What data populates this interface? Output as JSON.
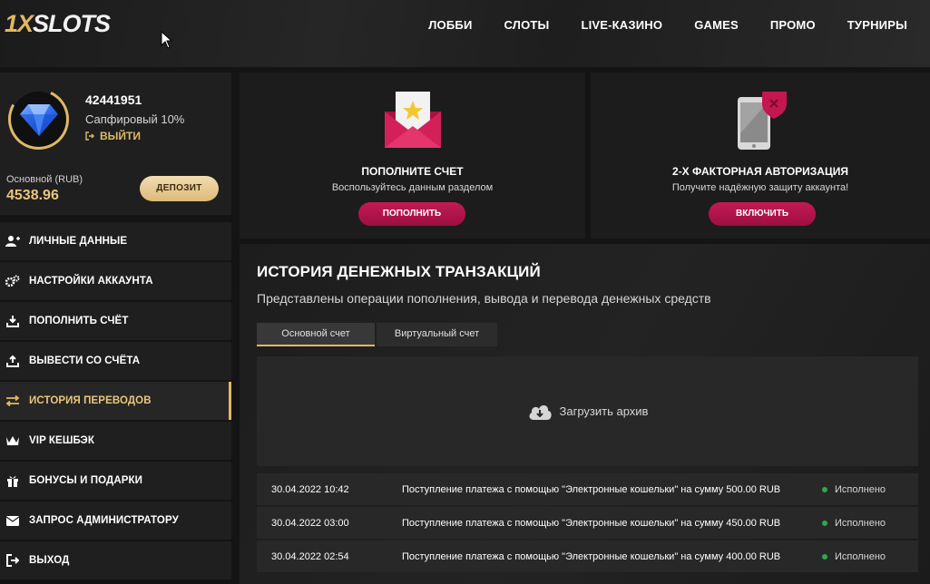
{
  "header": {
    "logo_part1": "1X",
    "logo_part2": "SLOTS",
    "nav": [
      "ЛОББИ",
      "СЛОТЫ",
      "LIVE-КАЗИНО",
      "GAMES",
      "ПРОМО",
      "ТУРНИРЫ"
    ]
  },
  "profile": {
    "user_id": "42441951",
    "level": "Сапфировый 10%",
    "logout_label": "ВЫЙТИ",
    "account_label": "Основной (RUB)",
    "balance": "4538.96",
    "deposit_label": "ДЕПОЗИТ",
    "avatar_icon": "diamond-icon"
  },
  "menu": [
    {
      "label": "ЛИЧНЫЕ ДАННЫЕ",
      "icon": "user-edit-icon"
    },
    {
      "label": "НАСТРОЙКИ АККАУНТА",
      "icon": "gears-icon"
    },
    {
      "label": "ПОПОЛНИТЬ СЧЁТ",
      "icon": "download-icon"
    },
    {
      "label": "ВЫВЕСТИ СО СЧЁТА",
      "icon": "upload-icon"
    },
    {
      "label": "ИСТОРИЯ ПЕРЕВОДОВ",
      "icon": "transfer-arrows-icon",
      "active": true
    },
    {
      "label": "VIP КЕШБЭК",
      "icon": "crown-icon"
    },
    {
      "label": "БОНУСЫ И ПОДАРКИ",
      "icon": "gift-icon"
    },
    {
      "label": "ЗАПРОС АДМИНИСТРАТОРУ",
      "icon": "envelope-icon"
    },
    {
      "label": "ВЫХОД",
      "icon": "logout-icon"
    }
  ],
  "promo": {
    "deposit_card": {
      "title": "ПОПОЛНИТЕ СЧЕТ",
      "subtitle": "Воспользуйтесь данным разделом",
      "button": "ПОПОЛНИТЬ",
      "icon": "envelope-star-icon"
    },
    "twofa_card": {
      "title": "2-Х ФАКТОРНАЯ АВТОРИЗАЦИЯ",
      "subtitle": "Получите надёжную защиту аккаунта!",
      "button": "ВКЛЮЧИТЬ",
      "icon": "phone-shield-icon"
    }
  },
  "main": {
    "title": "ИСТОРИЯ ДЕНЕЖНЫХ ТРАНЗАКЦИЙ",
    "subtitle": "Представлены операции пополнения, вывода и перевода денежных средств",
    "tabs": [
      "Основной счет",
      "Виртуальный счет"
    ],
    "active_tab": "Основной счет",
    "archive_label": "Загрузить архив",
    "transactions": [
      {
        "date": "30.04.2022 10:42",
        "description": "Поступление платежа с помощью \"Электронные кошельки\" на сумму 500.00 RUB",
        "status": "Исполнено"
      },
      {
        "date": "30.04.2022 03:00",
        "description": "Поступление платежа с помощью \"Электронные кошельки\" на сумму 450.00 RUB",
        "status": "Исполнено"
      },
      {
        "date": "30.04.2022 02:54",
        "description": "Поступление платежа с помощью \"Электронные кошельки\" на сумму 400.00 RUB",
        "status": "Исполнено"
      }
    ]
  },
  "colors": {
    "accent_gold": "#e0b865",
    "button_crimson": "#b5154d",
    "status_green": "#2ea74d"
  }
}
